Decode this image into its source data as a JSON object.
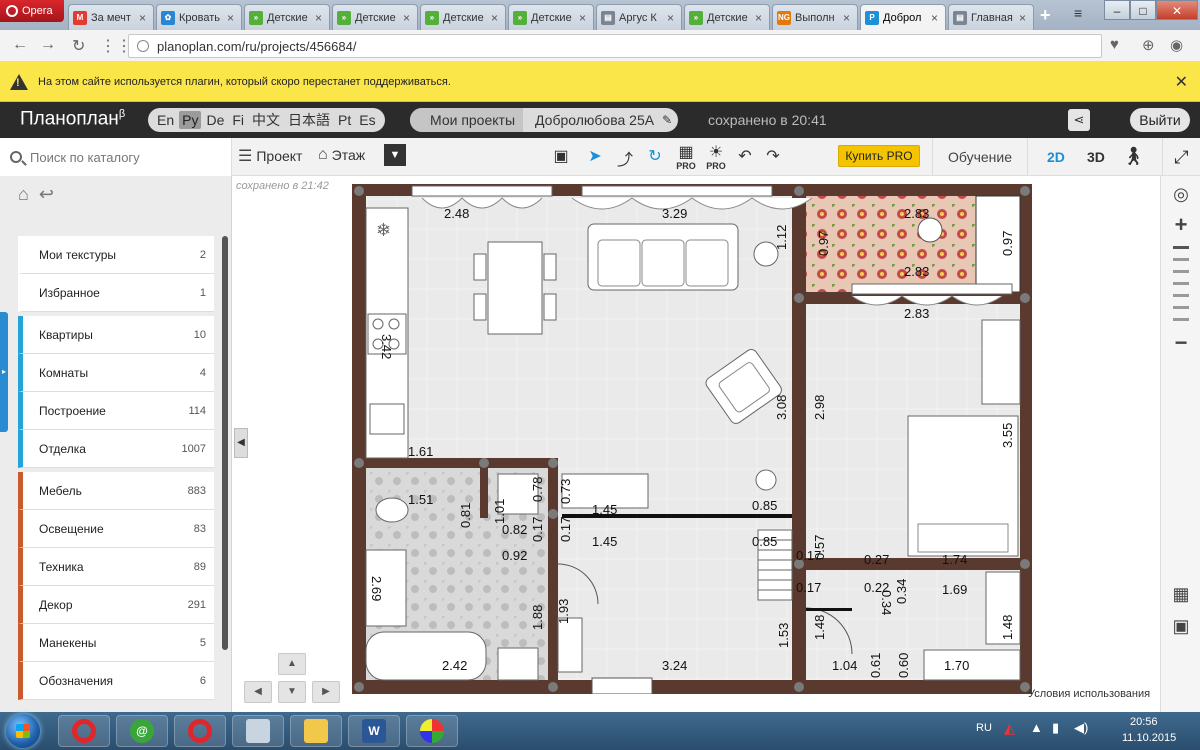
{
  "browser": {
    "menu_label": "Opera",
    "tabs": [
      {
        "label": "За мечт",
        "color": "#e23b2f",
        "fav": "M"
      },
      {
        "label": "Кровать",
        "color": "#2a86d4",
        "fav": "✿"
      },
      {
        "label": "Детские",
        "color": "#55b03b",
        "fav": "»"
      },
      {
        "label": "Детские",
        "color": "#55b03b",
        "fav": "»"
      },
      {
        "label": "Детские",
        "color": "#55b03b",
        "fav": "»"
      },
      {
        "label": "Детские",
        "color": "#55b03b",
        "fav": "»"
      },
      {
        "label": "Аргус К",
        "color": "#7a8594",
        "fav": "▤"
      },
      {
        "label": "Детские",
        "color": "#55b03b",
        "fav": "»"
      },
      {
        "label": "Выполн",
        "color": "#e07a10",
        "fav": "NG"
      },
      {
        "label": "Доброл",
        "color": "#1e90d6",
        "fav": "P"
      },
      {
        "label": "Главная",
        "color": "#7a8594",
        "fav": "▤"
      }
    ],
    "url": "planoplan.com/ru/projects/456684/",
    "plugin_warning": "На этом сайте используется плагин, который скоро перестанет поддерживаться."
  },
  "app": {
    "logo": "Планоплан",
    "logo_sup": "β",
    "languages": [
      "En",
      "Ру",
      "De",
      "Fi",
      "中文",
      "日本語",
      "Pt",
      "Es"
    ],
    "active_language": "Ру",
    "breadcrumb": {
      "parent": "Мои проекты",
      "current": "Добролюбова 25А"
    },
    "saved_header": "сохранено в 20:41",
    "logout": "Выйти"
  },
  "toolbar": {
    "search_placeholder": "Поиск по каталогу",
    "project": "Проект",
    "floor": "Этаж",
    "pro": "PRO",
    "buy_pro": "Купить PRO",
    "learn": "Обучение",
    "view_2d": "2D",
    "view_3d": "3D"
  },
  "catalog": [
    {
      "label": "Мои текстуры",
      "count": "2",
      "group": "none"
    },
    {
      "label": "Избранное",
      "count": "1",
      "group": "none"
    },
    {
      "label": "Квартиры",
      "count": "10",
      "group": "blue"
    },
    {
      "label": "Комнаты",
      "count": "4",
      "group": "blue"
    },
    {
      "label": "Построение",
      "count": "114",
      "group": "blue"
    },
    {
      "label": "Отделка",
      "count": "1007",
      "group": "blue"
    },
    {
      "label": "Мебель",
      "count": "883",
      "group": "orange"
    },
    {
      "label": "Освещение",
      "count": "83",
      "group": "orange"
    },
    {
      "label": "Техника",
      "count": "89",
      "group": "orange"
    },
    {
      "label": "Декор",
      "count": "291",
      "group": "orange"
    },
    {
      "label": "Манекены",
      "count": "5",
      "group": "orange"
    },
    {
      "label": "Обозначения",
      "count": "6",
      "group": "orange"
    }
  ],
  "canvas": {
    "saved_label": "сохранено в 21:42",
    "terms": "Условия использования"
  },
  "dimensions": {
    "d1": "2.48",
    "d2": "3.29",
    "d3": "2.83",
    "d4": "0.97",
    "d5": "0.97",
    "d6": "2.83",
    "d7": "2.83",
    "d8": "1.12",
    "d9": "3.42",
    "d10": "3.08",
    "d11": "2.98",
    "d12": "3.55",
    "d13": "1.61",
    "d14": "1.51",
    "d15": "0.81",
    "d16": "1.01",
    "d17": "0.78",
    "d18": "0.82",
    "d19": "0.73",
    "d20": "1.45",
    "d21": "1.45",
    "d22": "0.17",
    "d23": "0.17",
    "d24": "0.85",
    "d25": "0.85",
    "d26": "0.92",
    "d27": "0.57",
    "d28": "0.17",
    "d29": "0.17",
    "d30": "0.27",
    "d31": "0.22",
    "d32": "0.34",
    "d33": "0.34",
    "d34": "1.74",
    "d35": "1.69",
    "d36": "2.69",
    "d37": "1.88",
    "d38": "1.93",
    "d39": "1.53",
    "d40": "1.48",
    "d41": "1.48",
    "d42": "2.42",
    "d43": "3.24",
    "d44": "1.04",
    "d45": "0.61",
    "d46": "0.60",
    "d47": "1.70"
  },
  "taskbar": {
    "lang": "RU",
    "time": "20:56",
    "date": "11.10.2015"
  },
  "colors": {
    "wall": "#5a3a2f",
    "accent": "#1a8fd6",
    "buy_pro": "#f5c400",
    "warning": "#fbe64a"
  }
}
